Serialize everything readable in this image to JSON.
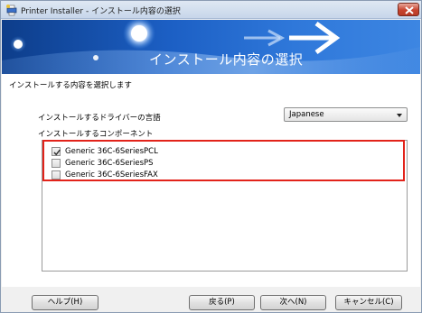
{
  "window": {
    "title": "Printer Installer - インストール内容の選択",
    "close_icon": "close-icon"
  },
  "banner": {
    "title": "インストール内容の選択"
  },
  "content": {
    "subtitle": "インストールする内容を選択します",
    "language_label": "インストールするドライバーの言語",
    "language_value": "Japanese",
    "components_label": "インストールするコンポーネント",
    "components": [
      {
        "label": "Generic 36C-6SeriesPCL",
        "checked": true
      },
      {
        "label": "Generic 36C-6SeriesPS",
        "checked": false
      },
      {
        "label": "Generic 36C-6SeriesFAX",
        "checked": false
      }
    ]
  },
  "footer": {
    "help": "ヘルプ(H)",
    "back": "戻る(P)",
    "next": "次へ(N)",
    "cancel": "キャンセル(C)"
  },
  "colors": {
    "highlight": "#e2231a",
    "banner": "#1c5fc4"
  }
}
